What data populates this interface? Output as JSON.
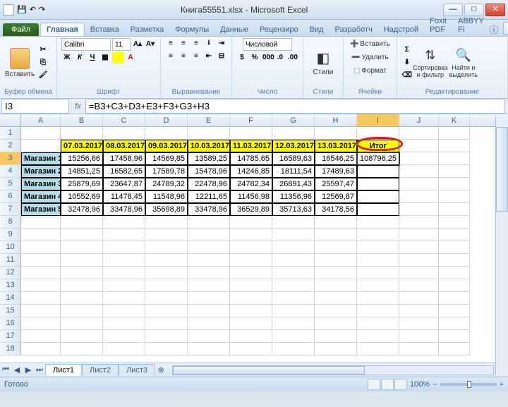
{
  "titlebar": {
    "title": "Книга55551.xlsx - Microsoft Excel"
  },
  "tabs": {
    "file": "Файл",
    "list": [
      "Главная",
      "Вставка",
      "Разметка",
      "Формулы",
      "Данные",
      "Рецензиро",
      "Вид",
      "Разработч",
      "Надстрой",
      "Foxit PDF",
      "ABBYY Fi"
    ],
    "active": 0
  },
  "ribbon": {
    "clipboard": {
      "label": "Буфер обмена",
      "paste": "Вставить"
    },
    "font": {
      "label": "Шрифт",
      "name": "Calibri",
      "size": "11",
      "bold": "Ж",
      "italic": "К",
      "underline": "Ч"
    },
    "align": {
      "label": "Выравнивание"
    },
    "number": {
      "label": "Число",
      "format": "Числовой"
    },
    "styles": {
      "label": "Стили",
      "btn": "Стили"
    },
    "cells": {
      "label": "Ячейки",
      "insert": "Вставить",
      "delete": "Удалить",
      "format": "Формат"
    },
    "editing": {
      "label": "Редактирование",
      "sort": "Сортировка и фильтр",
      "find": "Найти и выделить"
    }
  },
  "formula": {
    "namebox": "I3",
    "fx": "fx",
    "value": "=B3+C3+D3+E3+F3+G3+H3"
  },
  "cols": [
    "A",
    "B",
    "C",
    "D",
    "E",
    "F",
    "G",
    "H",
    "I",
    "J",
    "K"
  ],
  "headers": [
    "",
    "07.03.2017",
    "08.03.2017",
    "09.03.2017",
    "10.03.2017",
    "11.03.2017",
    "12.03.2017",
    "13.03.2017",
    "Итог"
  ],
  "rows": [
    {
      "store": "Магазин 1",
      "v": [
        "15256,66",
        "17458,96",
        "14569,85",
        "13589,25",
        "14785,65",
        "16589,63",
        "16546,25"
      ],
      "total": "108796,25"
    },
    {
      "store": "Магазин 2",
      "v": [
        "14851,25",
        "16582,65",
        "17589,78",
        "15478,96",
        "14246,85",
        "18111,54",
        "17489,63"
      ],
      "total": ""
    },
    {
      "store": "Магазин 3",
      "v": [
        "25879,69",
        "23647,87",
        "24789,32",
        "22478,96",
        "24782,34",
        "26891,43",
        "25597,47"
      ],
      "total": ""
    },
    {
      "store": "Магазин 4",
      "v": [
        "10552,69",
        "11478,45",
        "11548,96",
        "12211,65",
        "11456,98",
        "11356,96",
        "12569,87"
      ],
      "total": ""
    },
    {
      "store": "Магазин 5",
      "v": [
        "32478,96",
        "33478,96",
        "35698,89",
        "33478,96",
        "36529,89",
        "35713,63",
        "34178,56"
      ],
      "total": ""
    }
  ],
  "sheets": {
    "list": [
      "Лист1",
      "Лист2",
      "Лист3"
    ],
    "active": 0
  },
  "status": {
    "ready": "Готово",
    "zoom": "100%"
  }
}
